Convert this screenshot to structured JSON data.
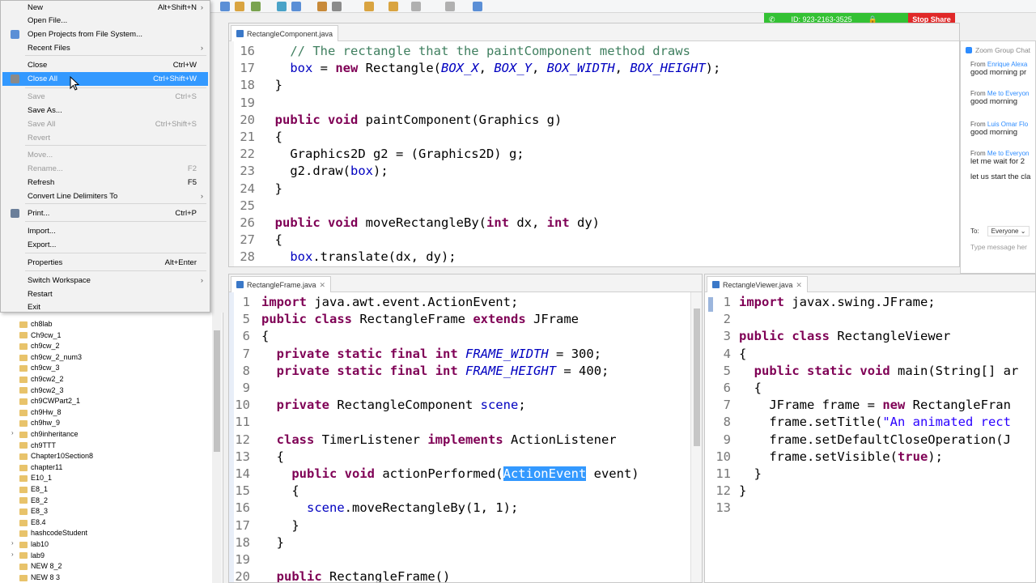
{
  "file_menu": {
    "items": [
      {
        "label": "New",
        "shortcut": "Alt+Shift+N",
        "submenu": true,
        "enabled": true
      },
      {
        "label": "Open File...",
        "shortcut": "",
        "enabled": true
      },
      {
        "label": "Open Projects from File System...",
        "shortcut": "",
        "enabled": true
      },
      {
        "label": "Recent Files",
        "shortcut": "",
        "submenu": true,
        "enabled": true
      },
      {
        "label": "Close",
        "shortcut": "Ctrl+W",
        "enabled": true
      },
      {
        "label": "Close All",
        "shortcut": "Ctrl+Shift+W",
        "enabled": true,
        "highlighted": true
      },
      {
        "label": "Save",
        "shortcut": "Ctrl+S",
        "enabled": false
      },
      {
        "label": "Save As...",
        "shortcut": "",
        "enabled": true
      },
      {
        "label": "Save All",
        "shortcut": "Ctrl+Shift+S",
        "enabled": false
      },
      {
        "label": "Revert",
        "shortcut": "",
        "enabled": false
      },
      {
        "label": "Move...",
        "shortcut": "",
        "enabled": false
      },
      {
        "label": "Rename...",
        "shortcut": "F2",
        "enabled": false
      },
      {
        "label": "Refresh",
        "shortcut": "F5",
        "enabled": true
      },
      {
        "label": "Convert Line Delimiters To",
        "shortcut": "",
        "submenu": true,
        "enabled": true
      },
      {
        "label": "Print...",
        "shortcut": "Ctrl+P",
        "enabled": true
      },
      {
        "label": "Import...",
        "shortcut": "",
        "enabled": true
      },
      {
        "label": "Export...",
        "shortcut": "",
        "enabled": true
      },
      {
        "label": "Properties",
        "shortcut": "Alt+Enter",
        "enabled": true
      },
      {
        "label": "Switch Workspace",
        "shortcut": "",
        "submenu": true,
        "enabled": true
      },
      {
        "label": "Restart",
        "shortcut": "",
        "enabled": true
      },
      {
        "label": "Exit",
        "shortcut": "",
        "enabled": true
      }
    ]
  },
  "explorer": {
    "items": [
      {
        "label": "ch8lab",
        "expandable": false
      },
      {
        "label": "Ch9cw_1",
        "expandable": false
      },
      {
        "label": "ch9cw_2",
        "expandable": false
      },
      {
        "label": "ch9cw_2_num3",
        "expandable": false
      },
      {
        "label": "ch9cw_3",
        "expandable": false
      },
      {
        "label": "ch9cw2_2",
        "expandable": false
      },
      {
        "label": "ch9cw2_3",
        "expandable": false
      },
      {
        "label": "ch9CWPart2_1",
        "expandable": false
      },
      {
        "label": "ch9Hw_8",
        "expandable": false
      },
      {
        "label": "ch9hw_9",
        "expandable": false
      },
      {
        "label": "ch9inheritance",
        "expandable": true
      },
      {
        "label": "ch9TTT",
        "expandable": false
      },
      {
        "label": "Chapter10Section8",
        "expandable": false
      },
      {
        "label": "chapter11",
        "expandable": false
      },
      {
        "label": "E10_1",
        "expandable": false
      },
      {
        "label": "E8_1",
        "expandable": false
      },
      {
        "label": "E8_2",
        "expandable": false
      },
      {
        "label": "E8_3",
        "expandable": false
      },
      {
        "label": "E8.4",
        "expandable": false
      },
      {
        "label": "hashcodeStudent",
        "expandable": false
      },
      {
        "label": "lab10",
        "expandable": true
      },
      {
        "label": "lab9",
        "expandable": true
      },
      {
        "label": "NEW 8_2",
        "expandable": false
      },
      {
        "label": "NEW 8 3",
        "expandable": false
      }
    ]
  },
  "zoom_share": {
    "meeting_id": "ID: 923-2163-3525",
    "stop_label": "Stop Share"
  },
  "chat": {
    "title": "Zoom Group Chat",
    "messages": [
      {
        "from": "From",
        "sender": "Enrique Alexa",
        "text": "good morning pr"
      },
      {
        "from": "From",
        "sender": "Me to Everyon",
        "text": "good morning"
      },
      {
        "from": "From",
        "sender": "Luis Omar Flo",
        "text": "good morning"
      },
      {
        "from": "From",
        "sender": "Me to Everyon",
        "text": "let me wait for 2"
      },
      {
        "from": "",
        "sender": "",
        "text": "let us start the cla"
      }
    ],
    "to_label": "To:",
    "to_value": "Everyone",
    "input_placeholder": "Type message her"
  },
  "editor_component": {
    "tab": "RectangleComponent.java",
    "lines": [
      {
        "n": "16",
        "html": "    <span class=\"cm\">// The rectangle that the paintComponent method draws</span>"
      },
      {
        "n": "17",
        "html": "    <span class=\"fld\">box</span> = <span class=\"kw\">new</span> Rectangle(<span class=\"cst\">BOX_X</span>, <span class=\"cst\">BOX_Y</span>, <span class=\"cst\">BOX_WIDTH</span>, <span class=\"cst\">BOX_HEIGHT</span>);"
      },
      {
        "n": "18",
        "html": "  }"
      },
      {
        "n": "19",
        "html": ""
      },
      {
        "n": "20",
        "html": "  <span class=\"kw\">public</span> <span class=\"kw\">void</span> paintComponent(Graphics g)"
      },
      {
        "n": "21",
        "html": "  {"
      },
      {
        "n": "22",
        "html": "    Graphics2D g2 = (Graphics2D) g;"
      },
      {
        "n": "23",
        "html": "    g2.draw(<span class=\"fld\">box</span>);"
      },
      {
        "n": "24",
        "html": "  }"
      },
      {
        "n": "25",
        "html": ""
      },
      {
        "n": "26",
        "html": "  <span class=\"kw\">public</span> <span class=\"kw\">void</span> moveRectangleBy(<span class=\"kw\">int</span> dx, <span class=\"kw\">int</span> dy)"
      },
      {
        "n": "27",
        "html": "  {"
      },
      {
        "n": "28",
        "html": "    <span class=\"fld\">box</span>.translate(dx, dy);"
      }
    ]
  },
  "editor_frame": {
    "tab": "RectangleFrame.java",
    "lines": [
      {
        "n": "1",
        "html": "<span class=\"kw\">import</span> java.awt.event.ActionEvent;"
      },
      {
        "n": "5",
        "html": "<span class=\"kw\">public</span> <span class=\"kw\">class</span> RectangleFrame <span class=\"kw\">extends</span> JFrame"
      },
      {
        "n": "6",
        "html": "{"
      },
      {
        "n": "7",
        "html": "  <span class=\"kw\">private</span> <span class=\"kw\">static</span> <span class=\"kw\">final</span> <span class=\"kw\">int</span> <span class=\"cst\">FRAME_WIDTH</span> = 300;"
      },
      {
        "n": "8",
        "html": "  <span class=\"kw\">private</span> <span class=\"kw\">static</span> <span class=\"kw\">final</span> <span class=\"kw\">int</span> <span class=\"cst\">FRAME_HEIGHT</span> = 400;"
      },
      {
        "n": "9",
        "html": ""
      },
      {
        "n": "10",
        "html": "  <span class=\"kw\">private</span> RectangleComponent <span class=\"fld\">scene</span>;"
      },
      {
        "n": "11",
        "html": ""
      },
      {
        "n": "12",
        "html": "  <span class=\"kw\">class</span> TimerListener <span class=\"kw\">implements</span> ActionListener"
      },
      {
        "n": "13",
        "html": "  {"
      },
      {
        "n": "14",
        "html": "    <span class=\"kw\">public</span> <span class=\"kw\">void</span> actionPerformed(<span class=\"sel\">ActionEvent</span> event)"
      },
      {
        "n": "15",
        "html": "    {"
      },
      {
        "n": "16",
        "html": "      <span class=\"fld\">scene</span>.moveRectangleBy(1, 1);"
      },
      {
        "n": "17",
        "html": "    }"
      },
      {
        "n": "18",
        "html": "  }"
      },
      {
        "n": "19",
        "html": ""
      },
      {
        "n": "20",
        "html": "  <span class=\"kw\">public</span> RectangleFrame()"
      }
    ]
  },
  "editor_viewer": {
    "tab": "RectangleViewer.java",
    "lines": [
      {
        "n": "1",
        "html": "<span class=\"kw\">import</span> javax.swing.JFrame;"
      },
      {
        "n": "2",
        "html": ""
      },
      {
        "n": "3",
        "html": "<span class=\"kw\">public</span> <span class=\"kw\">class</span> RectangleViewer"
      },
      {
        "n": "4",
        "html": "{"
      },
      {
        "n": "5",
        "html": "  <span class=\"kw\">public</span> <span class=\"kw\">static</span> <span class=\"kw\">void</span> main(String[] ar"
      },
      {
        "n": "6",
        "html": "  {"
      },
      {
        "n": "7",
        "html": "    JFrame frame = <span class=\"kw\">new</span> RectangleFran"
      },
      {
        "n": "8",
        "html": "    frame.setTitle(<span class=\"str\">\"An animated rect</span>"
      },
      {
        "n": "9",
        "html": "    frame.setDefaultCloseOperation(J"
      },
      {
        "n": "10",
        "html": "    frame.setVisible(<span class=\"kw\">true</span>);"
      },
      {
        "n": "11",
        "html": "  }"
      },
      {
        "n": "12",
        "html": "}"
      },
      {
        "n": "13",
        "html": ""
      }
    ]
  },
  "colors": {
    "keyword": "#7f0055",
    "comment": "#3f7f5f",
    "field": "#0000c0",
    "selection": "#3399ff",
    "zoom_green": "#33c133",
    "zoom_red": "#e02828"
  }
}
